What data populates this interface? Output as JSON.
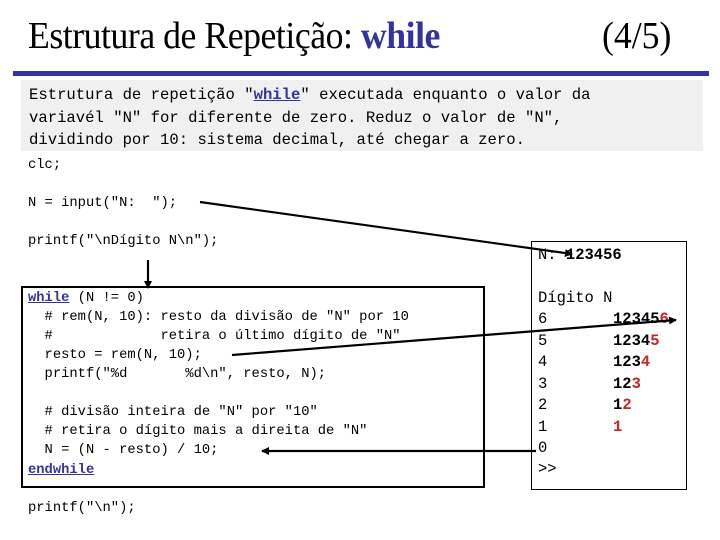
{
  "slide": {
    "title_prefix": "Estrutura de Repetição: ",
    "title_keyword": "while",
    "page_indicator": "(4/5)",
    "accent_color": "#3333a0",
    "highlight_color": "#cc2222"
  },
  "description": {
    "line1_before": "Estrutura de repetição \"",
    "line1_keyword": "while",
    "line1_after": "\" executada enquanto o valor da",
    "line2": "variavél \"N\" for diferente de zero. Reduz o valor de \"N\",",
    "line3": "dividindo por 10: sistema decimal, até chegar a zero."
  },
  "code": {
    "clc": "clc;",
    "input": "N = input(\"N:  \");",
    "printf_header": "printf(\"\\nDígito N\\n\");",
    "while_keyword": "while",
    "while_cond": " (N != 0)",
    "loop_lines": [
      "  # rem(N, 10): resto da divisão de \"N\" por 10",
      "  #             retira o último dígito de \"N\"",
      "  resto = rem(N, 10);",
      "  printf(\"%d       %d\\n\", resto, N);",
      "",
      "  # divisão inteira de \"N\" por \"10\"",
      "  # retira o dígito mais a direita de \"N\"",
      "  N = (N - resto) / 10;"
    ],
    "endwhile_keyword": "endwhile",
    "printf_end": "printf(\"\\n\");"
  },
  "output": {
    "prompt_label": "N: ",
    "prompt_value": "123456",
    "header": "Dígito N",
    "rows": [
      {
        "digit": "6",
        "n_black": "12345",
        "n_red": "6"
      },
      {
        "digit": "5",
        "n_black": "1234",
        "n_red": "5"
      },
      {
        "digit": "4",
        "n_black": "123",
        "n_red": "4"
      },
      {
        "digit": "3",
        "n_black": "12",
        "n_red": "3"
      },
      {
        "digit": "2",
        "n_black": "1",
        "n_red": "2"
      },
      {
        "digit": "1",
        "n_black": "",
        "n_red": "1"
      }
    ],
    "final_digit": "0",
    "console_prompt": ">>"
  }
}
